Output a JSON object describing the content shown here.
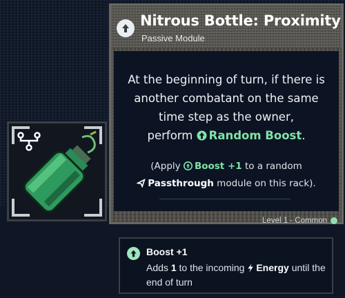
{
  "card": {
    "title": "Nitrous Bottle: Proximity",
    "subtitle": "Passive Module",
    "desc_line1": "At the beginning of turn, if there is",
    "desc_line2": "another combatant on the same",
    "desc_line3": "time step as the owner,",
    "desc_perform": "perform",
    "desc_action": "Random Boost",
    "desc_end": ".",
    "note_open": "(Apply",
    "note_boost": "Boost +1",
    "note_mid": "to a random",
    "note_passthrough": "Passthrough",
    "note_end": "module on this rack).",
    "footer": "Level 1 - Common"
  },
  "tooltip": {
    "title": "Boost +1",
    "text_pre": "Adds",
    "text_amount": "1",
    "text_mid": "to the incoming",
    "text_energy": "Energy",
    "text_post": "until the end of turn"
  },
  "colors": {
    "accent_green": "#7fe3a9",
    "rarity_common": "#8fe0b0",
    "bottle_green": "#3fae6a"
  },
  "icons": {
    "header": "boost-circle-icon",
    "slot_type": "branch-nodes-icon",
    "action": "boost-circle-icon",
    "passthrough": "arrow-send-icon",
    "energy": "lightning-icon"
  }
}
